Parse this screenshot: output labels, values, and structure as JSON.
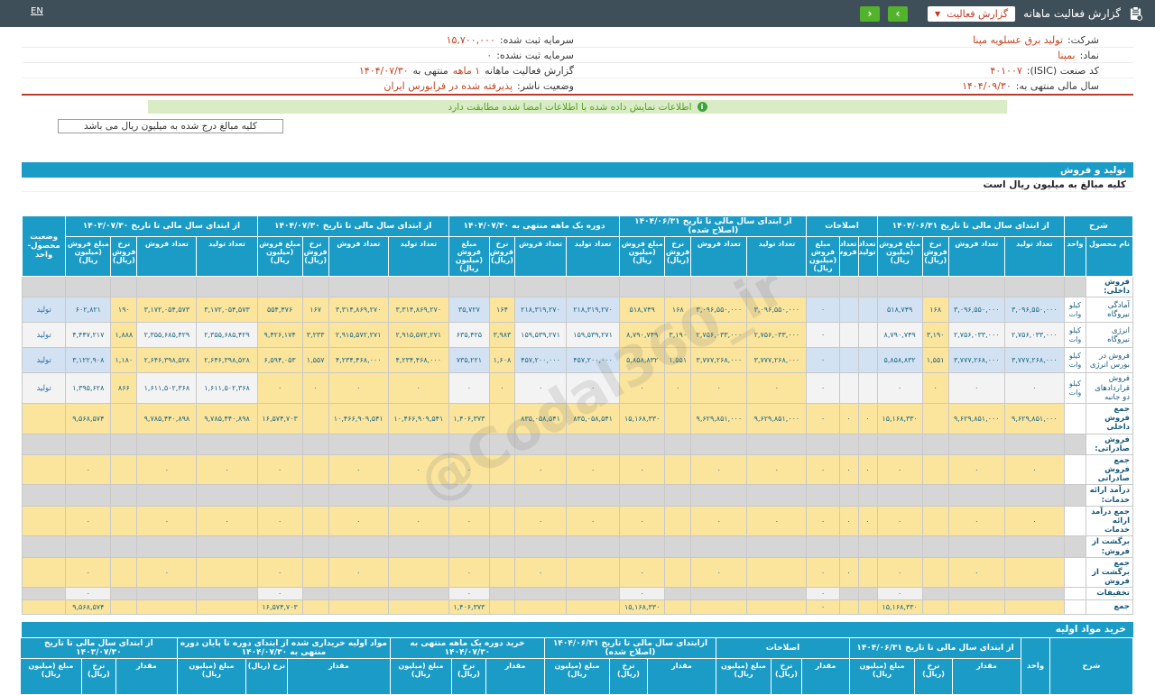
{
  "colors": {
    "topbar": "#3e4f59",
    "accent_teal": "#1b9cc7",
    "highlight_yellow": "#fbe49c",
    "row_blue": "#d2e2f2",
    "notice_green_bg": "#d9ecc5",
    "value_red": "#c2431f",
    "nav_button_green": "#53b32b"
  },
  "topbar": {
    "lang": "EN",
    "title": "گزارش فعالیت ماهانه",
    "dropdown_label": "گزارش فعالیت",
    "dropdown_caret": "▼",
    "next": "›",
    "prev": "‹"
  },
  "info": {
    "right": [
      {
        "label": "شرکت:",
        "value": "تولید برق عسلویه مپنا"
      },
      {
        "label": "نماد:",
        "value": "بمپنا"
      },
      {
        "label": "کد صنعت (ISIC):",
        "value": "۴۰۱۰۰۷"
      },
      {
        "label": "سال مالی منتهی به:",
        "value": "۱۴۰۴/۰۹/۳۰"
      }
    ],
    "left": [
      {
        "label": "سرمایه ثبت شده:",
        "value": "۱۵,۷۰۰,۰۰۰"
      },
      {
        "label": "سرمایه ثبت نشده:",
        "value": "۰"
      }
    ],
    "report_row": {
      "label": "گزارش فعالیت ماهانه",
      "period": "۱ ماهه",
      "connector": "منتهی به",
      "date": "۱۴۰۴/۰۷/۳۰"
    },
    "publisher_row": {
      "label": "وضعیت ناشر:",
      "value": "پذیرفته شده در فرابورس ایران"
    }
  },
  "notice": {
    "text": "اطلاعات نمایش داده شده با اطلاعات امضا شده مطابقت دارد",
    "icon": "i"
  },
  "amounts_note": "کلیه مبالغ درج شده به میلیون ریال می باشد",
  "section1": {
    "title": "تولید و فروش",
    "subtitle": "کلیه مبالغ به میلیون ریال است"
  },
  "section2": {
    "title": "خرید مواد اولیه"
  },
  "watermark": "@Codal360_ir",
  "table1": {
    "header": {
      "groups": [
        {
          "label": "شرح",
          "cols": [
            "نام محصول",
            "واحد"
          ]
        },
        {
          "label": "از ابتدای سال مالی تا تاریخ ۱۴۰۴/۰۶/۳۱",
          "cols": [
            "تعداد تولید",
            "تعداد فروش",
            "نرخ فروش (ریال)",
            "مبلغ فروش (میلیون ریال)"
          ]
        },
        {
          "label": "اصلاحات",
          "cols": [
            "تعداد تولید",
            "تعداد فروش",
            "مبلغ فروش (میلیون ریال)"
          ]
        },
        {
          "label": "از ابتدای سال مالی تا تاریخ ۱۴۰۴/۰۶/۳۱ (اصلاح شده)",
          "cols": [
            "تعداد تولید",
            "تعداد فروش",
            "نرخ فروش (ریال)",
            "مبلغ فروش (میلیون ریال)"
          ]
        },
        {
          "label": "دوره یک ماهه منتهی به ۱۴۰۴/۰۷/۳۰",
          "cols": [
            "تعداد تولید",
            "تعداد فروش",
            "نرخ فروش (ریال)",
            "مبلغ فروش (میلیون ریال)"
          ]
        },
        {
          "label": "از ابتدای سال مالی تا تاریخ ۱۴۰۴/۰۷/۳۰",
          "cols": [
            "تعداد تولید",
            "تعداد فروش",
            "نرخ فروش (ریال)",
            "مبلغ فروش (میلیون ریال)"
          ]
        },
        {
          "label": "از ابتدای سال مالی تا تاریخ ۱۴۰۳/۰۷/۳۰",
          "cols": [
            "تعداد تولید",
            "تعداد فروش",
            "نرخ فروش (ریال)",
            "مبلغ فروش (میلیون ریال)"
          ]
        },
        {
          "label": "وضعیت محصول- واحد",
          "cols": []
        }
      ]
    },
    "rows": [
      {
        "type": "section",
        "label": "فروش داخلی:"
      },
      {
        "type": "data",
        "odd": true,
        "label": "آمادگی نیروگاه",
        "unit": "کیلو وات",
        "status": "تولید",
        "c": [
          "۳,۰۹۶,۵۵۰,۰۰۰",
          "۳,۰۹۶,۵۵۰,۰۰۰",
          "۱۶۸",
          "۵۱۸,۷۴۹",
          "",
          "",
          "۰",
          "۳,۰۹۶,۵۵۰,۰۰۰",
          "۳,۰۹۶,۵۵۰,۰۰۰",
          "۱۶۸",
          "۵۱۸,۷۴۹",
          "۲۱۸,۳۱۹,۲۷۰",
          "۲۱۸,۳۱۹,۲۷۰",
          "۱۶۴",
          "۳۵,۷۲۷",
          "۳,۳۱۴,۸۶۹,۲۷۰",
          "۳,۳۱۴,۸۶۹,۲۷۰",
          "۱۶۷",
          "۵۵۴,۴۷۶",
          "۳,۱۷۲,۰۵۴,۵۷۳",
          "۳,۱۷۲,۰۵۴,۵۷۳",
          "۱۹۰",
          "۶۰۲,۸۲۱"
        ]
      },
      {
        "type": "data",
        "odd": false,
        "label": "انرژی نیروگاه",
        "unit": "کیلو وات",
        "status": "تولید",
        "c": [
          "۲,۷۵۶,۰۳۳,۰۰۰",
          "۲,۷۵۶,۰۳۳,۰۰۰",
          "۳,۱۹۰",
          "۸,۷۹۰,۷۴۹",
          "",
          "",
          "۰",
          "۲,۷۵۶,۰۳۳,۰۰۰",
          "۲,۷۵۶,۰۳۳,۰۰۰",
          "۳,۱۹۰",
          "۸,۷۹۰,۷۴۹",
          "۱۵۹,۵۳۹,۲۷۱",
          "۱۵۹,۵۳۹,۲۷۱",
          "۳,۹۸۳",
          "۶۳۵,۴۲۵",
          "۲,۹۱۵,۵۷۲,۲۷۱",
          "۲,۹۱۵,۵۷۲,۲۷۱",
          "۳,۲۳۳",
          "۹,۴۲۶,۱۷۴",
          "۲,۳۵۵,۶۸۵,۴۲۹",
          "۲,۳۵۵,۶۸۵,۴۲۹",
          "۱,۸۸۸",
          "۴,۴۴۷,۲۱۷"
        ]
      },
      {
        "type": "data",
        "odd": true,
        "label": "فروش در بورس انرژی",
        "unit": "کیلو وات",
        "status": "تولید",
        "c": [
          "۳,۷۷۷,۲۶۸,۰۰۰",
          "۳,۷۷۷,۲۶۸,۰۰۰",
          "۱,۵۵۱",
          "۵,۸۵۸,۸۳۲",
          "",
          "",
          "۰",
          "۳,۷۷۷,۲۶۸,۰۰۰",
          "۳,۷۷۷,۲۶۸,۰۰۰",
          "۱,۵۵۱",
          "۵,۸۵۸,۸۳۲",
          "۴۵۷,۲۰۰,۰۰۰",
          "۴۵۷,۲۰۰,۰۰۰",
          "۱,۶۰۸",
          "۷۳۵,۲۲۱",
          "۴,۲۳۴,۴۶۸,۰۰۰",
          "۴,۲۳۴,۴۶۸,۰۰۰",
          "۱,۵۵۷",
          "۶,۵۹۴,۰۵۳",
          "۲,۶۴۶,۳۹۸,۵۲۸",
          "۲,۶۴۶,۳۹۸,۵۲۸",
          "۱,۱۸۰",
          "۳,۱۲۲,۹۰۸"
        ]
      },
      {
        "type": "data",
        "odd": false,
        "label": "فروش قراردادهای دو جانبه",
        "unit": "کیلو وات",
        "status": "تولید",
        "c": [
          "۰",
          "۰",
          "۰",
          "۰",
          "",
          "",
          "۰",
          "۰",
          "۰",
          "۰",
          "۰",
          "۰",
          "۰",
          "۰",
          "۰",
          "۰",
          "۰",
          "۰",
          "۰",
          "۱,۶۱۱,۵۰۲,۳۶۸",
          "۱,۶۱۱,۵۰۲,۳۶۸",
          "۸۶۶",
          "۱,۳۹۵,۶۲۸"
        ]
      },
      {
        "type": "total",
        "label": "جمع فروش داخلی",
        "c": [
          "۹,۶۲۹,۸۵۱,۰۰۰",
          "۹,۶۲۹,۸۵۱,۰۰۰",
          "",
          "۱۵,۱۶۸,۳۳۰",
          "۰",
          "۰",
          "۰",
          "۹,۶۲۹,۸۵۱,۰۰۰",
          "۹,۶۲۹,۸۵۱,۰۰۰",
          "",
          "۱۵,۱۶۸,۳۳۰",
          "۸۳۵,۰۵۸,۵۴۱",
          "۸۳۵,۰۵۸,۵۴۱",
          "",
          "۱,۴۰۶,۳۷۳",
          "۱۰,۴۶۶,۹۰۹,۵۴۱",
          "۱۰,۴۶۶,۹۰۹,۵۴۱",
          "",
          "۱۶,۵۷۴,۷۰۳",
          "۹,۷۸۵,۴۴۰,۸۹۸",
          "۹,۷۸۵,۴۴۰,۸۹۸",
          "",
          "۹,۵۶۸,۵۷۴"
        ]
      },
      {
        "type": "section",
        "label": "فروش صادراتی:"
      },
      {
        "type": "total",
        "label": "جمع فروش صادراتی",
        "c": [
          "۰",
          "۰",
          "",
          "۰",
          "۰",
          "۰",
          "۰",
          "۰",
          "۰",
          "",
          "۰",
          "۰",
          "۰",
          "",
          "۰",
          "۰",
          "۰",
          "",
          "۰",
          "۰",
          "۰",
          "",
          "۰"
        ]
      },
      {
        "type": "section",
        "label": "درآمد ارائه خدمات:"
      },
      {
        "type": "total",
        "label": "جمع درآمد ارائه خدمات",
        "c": [
          "۰",
          "۰",
          "",
          "۰",
          "۰",
          "۰",
          "۰",
          "۰",
          "۰",
          "",
          "۰",
          "۰",
          "۰",
          "",
          "۰",
          "۰",
          "۰",
          "",
          "۰",
          "۰",
          "۰",
          "",
          "۰"
        ]
      },
      {
        "type": "section",
        "label": "برگشت از فروش:"
      },
      {
        "type": "total",
        "label": "جمع برگشت از فروش",
        "c": [
          "",
          "۰",
          "",
          "۰",
          "",
          "۰",
          "۰",
          "",
          "۰",
          "",
          "۰",
          "",
          "۰",
          "",
          "۰",
          "",
          "۰",
          "",
          "۰",
          "",
          "۰",
          "",
          "۰"
        ]
      },
      {
        "type": "dim",
        "label": "تخفیفات",
        "c": [
          "",
          "",
          "",
          "۰",
          "",
          "",
          "۰",
          "",
          "",
          "",
          "۰",
          "",
          "",
          "",
          "۰",
          "",
          "",
          "",
          "۰",
          "",
          "",
          "",
          "۰"
        ]
      },
      {
        "type": "grand",
        "label": "جمع",
        "c": [
          "",
          "",
          "",
          "۱۵,۱۶۸,۳۳۰",
          "",
          "",
          "۰",
          "",
          "",
          "",
          "۱۵,۱۶۸,۳۳۰",
          "",
          "",
          "",
          "۱,۴۰۶,۳۷۳",
          "",
          "",
          "",
          "۱۶,۵۷۴,۷۰۳",
          "",
          "",
          "",
          "۹,۵۶۸,۵۷۴"
        ]
      }
    ]
  },
  "table2": {
    "header": {
      "groups": [
        {
          "label": "شرح",
          "cols": []
        },
        {
          "label": "واحد",
          "cols": []
        },
        {
          "label": "از ابتدای سال مالی تا تاریخ ۱۴۰۴/۰۶/۳۱",
          "cols": [
            "مقدار",
            "نرخ (ریال)",
            "مبلغ (میلیون ریال)"
          ]
        },
        {
          "label": "اصلاحات",
          "cols": [
            "مقدار",
            "نرخ (ریال)",
            "مبلغ (میلیون ریال)"
          ]
        },
        {
          "label": "ازابتدای سال مالی تا تاریخ ۱۴۰۴/۰۶/۳۱ (اصلاح شده)",
          "cols": [
            "مقدار",
            "نرخ (ریال)",
            "مبلغ (میلیون ریال)"
          ]
        },
        {
          "label": "خرید دوره یک ماهه منتهی به ۱۴۰۴/۰۷/۳۰",
          "cols": [
            "مقدار",
            "نرخ (ریال)",
            "مبلغ (میلیون ریال)"
          ]
        },
        {
          "label": "مواد اولیه خریداری شده از ابتدای دوره تا پایان دوره منتهی به ۱۴۰۴/۰۷/۳۰",
          "cols": [
            "مقدار",
            "نرخ (ریال)",
            "مبلغ (میلیون ریال)"
          ]
        },
        {
          "label": "از ابتدای سال مالی تا تاریخ ۱۴۰۳/۰۷/۳۰",
          "cols": [
            "مقدار",
            "نرخ (ریال)",
            "مبلغ (میلیون ریال)"
          ]
        }
      ]
    }
  }
}
